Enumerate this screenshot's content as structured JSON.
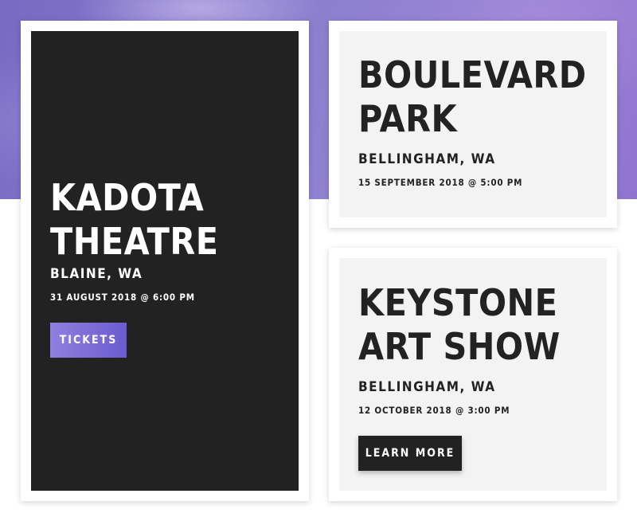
{
  "events": [
    {
      "title_lines": [
        "KADOTA",
        "THEATRE"
      ],
      "city": "BLAINE, WA",
      "date": "31 AUGUST 2018 @ 6:00 PM",
      "button_label": "TICKETS"
    },
    {
      "title_lines": [
        "BOULEVARD",
        "PARK"
      ],
      "city": "BELLINGHAM, WA",
      "date": "15 SEPTEMBER 2018 @ 5:00 PM"
    },
    {
      "title_lines": [
        "KEYSTONE",
        "ART SHOW"
      ],
      "city": "BELLINGHAM, WA",
      "date": "12 OCTOBER 2018 @ 3:00 PM",
      "button_label": "LEARN MORE"
    }
  ],
  "colors": {
    "hero_purple": "#8b7fce",
    "dark_card": "#222222",
    "light_card": "#f3f3f3",
    "button_gradient_start": "#8f80de",
    "button_gradient_end": "#6c5bd0"
  }
}
